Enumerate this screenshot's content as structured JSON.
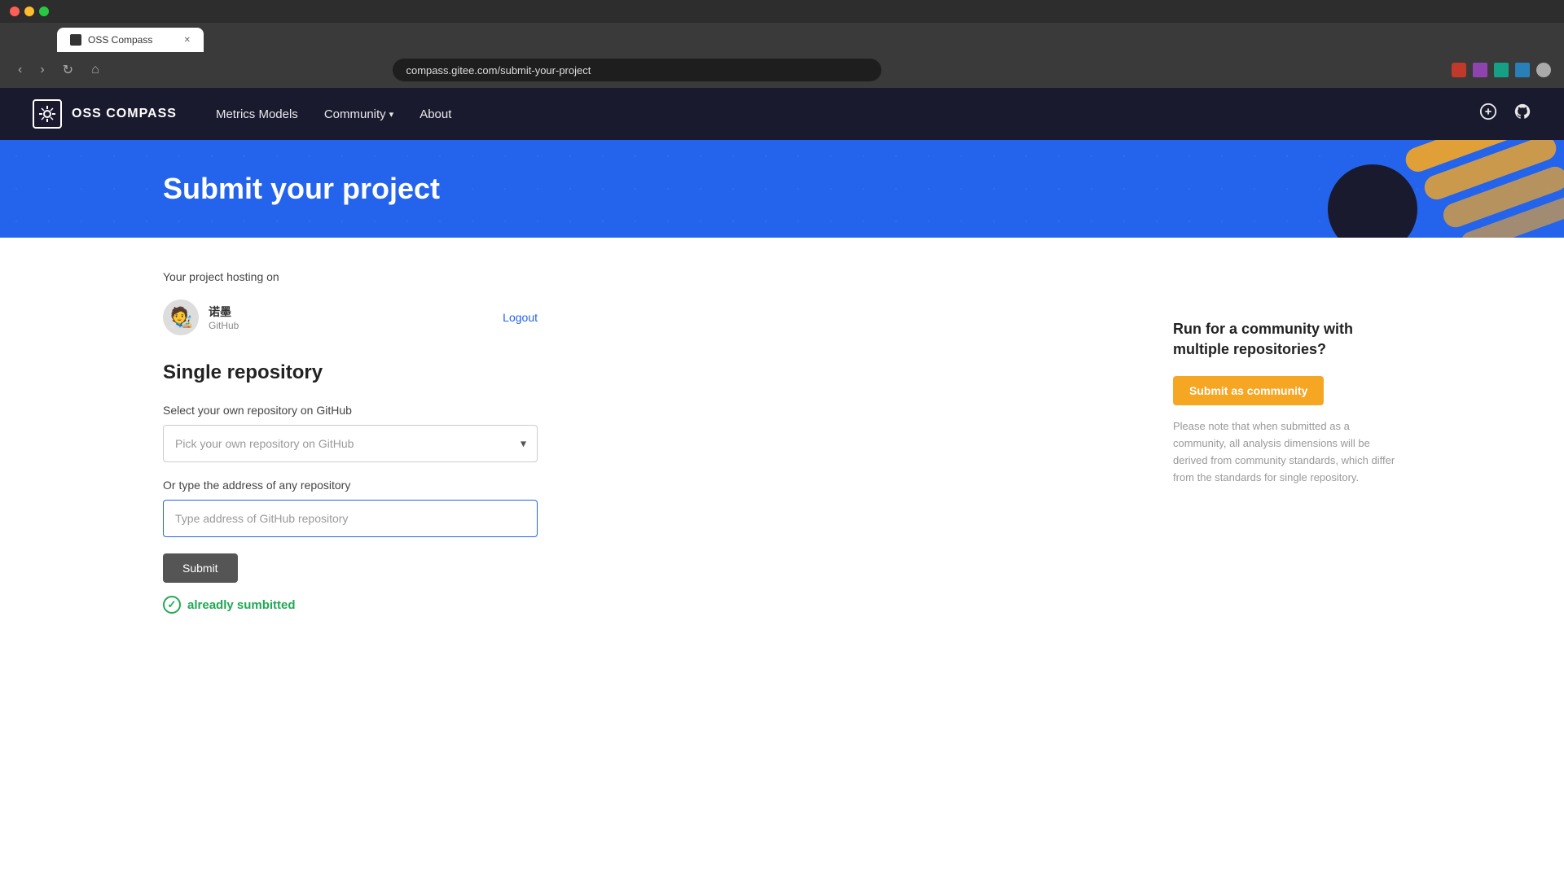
{
  "browser": {
    "traffic_lights": [
      "red",
      "yellow",
      "green"
    ],
    "tab_title": "OSS Compass",
    "tab_url": "compass.gitee.com/submit-your-project",
    "address": "compass.gitee.com/submit-your-project"
  },
  "header": {
    "logo_text": "OSS COMPASS",
    "nav": {
      "metrics_models": "Metrics Models",
      "community": "Community",
      "about": "About"
    }
  },
  "hero": {
    "title": "Submit your project"
  },
  "form": {
    "hosting_label": "Your project hosting on",
    "user_name": "诺墨",
    "user_platform": "GitHub",
    "logout_label": "Logout",
    "section_title": "Single repository",
    "select_label": "Select your own repository on GitHub",
    "select_placeholder": "Pick your own repository on GitHub",
    "type_label": "Or type the address of any repository",
    "type_placeholder": "Type address of GitHub repository",
    "submit_label": "Submit",
    "success_msg": "alreadly sumbitted"
  },
  "community_panel": {
    "title": "Run for a community with multiple repositories?",
    "button_label": "Submit as community",
    "note": "Please note that when submitted as a community, all analysis dimensions will be derived from community standards, which differ from the standards for single repository."
  }
}
